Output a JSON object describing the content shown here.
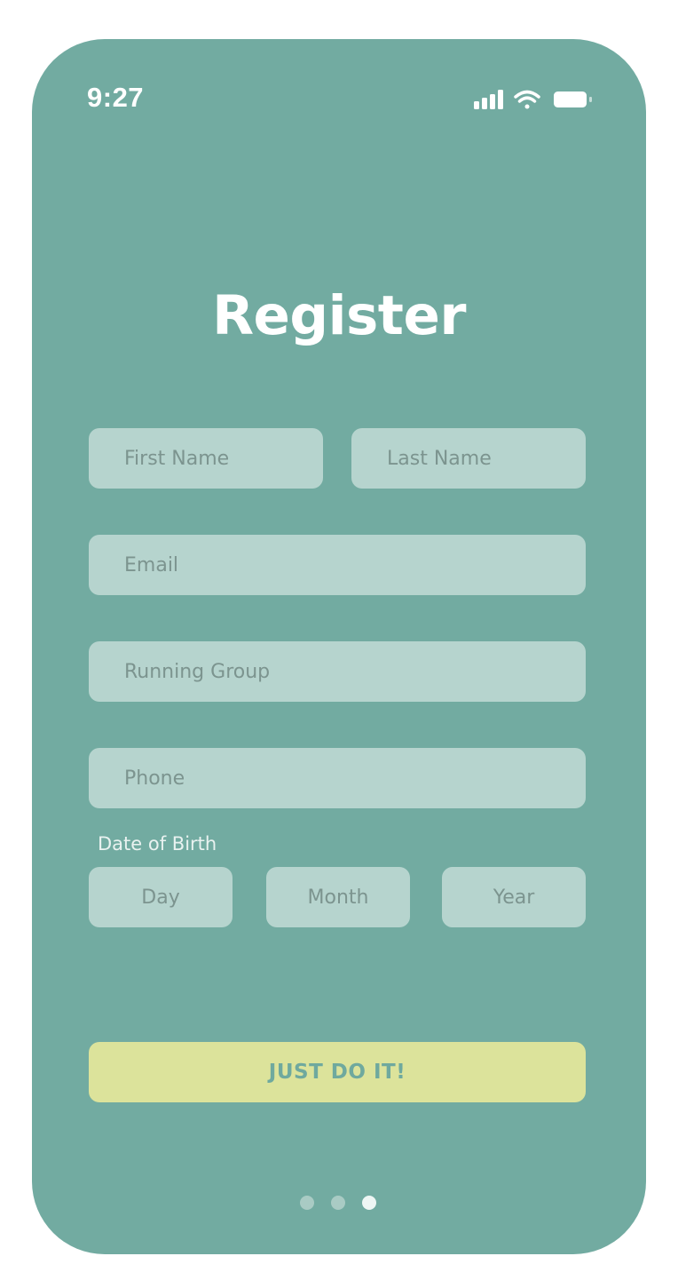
{
  "status_bar": {
    "time": "9:27",
    "icons": [
      "signal-icon",
      "wifi-icon",
      "battery-icon"
    ]
  },
  "screen": {
    "title": "Register"
  },
  "form": {
    "first_name": {
      "placeholder": "First Name",
      "value": ""
    },
    "last_name": {
      "placeholder": "Last Name",
      "value": ""
    },
    "email": {
      "placeholder": "Email",
      "value": ""
    },
    "running_group": {
      "placeholder": "Running Group",
      "value": ""
    },
    "phone": {
      "placeholder": "Phone",
      "value": ""
    },
    "dob": {
      "label": "Date of Birth",
      "day": {
        "placeholder": "Day",
        "value": ""
      },
      "month": {
        "placeholder": "Month",
        "value": ""
      },
      "year": {
        "placeholder": "Year",
        "value": ""
      }
    },
    "submit_label": "JUST DO IT!"
  },
  "pagination": {
    "total": 3,
    "active_index": 2
  },
  "colors": {
    "background": "#72aba1",
    "field": "#b6d4ce",
    "button": "#dce39b",
    "button_text": "#6fa99e",
    "dot_inactive": "#a9cbc4",
    "dot_active": "#eef6f4"
  }
}
